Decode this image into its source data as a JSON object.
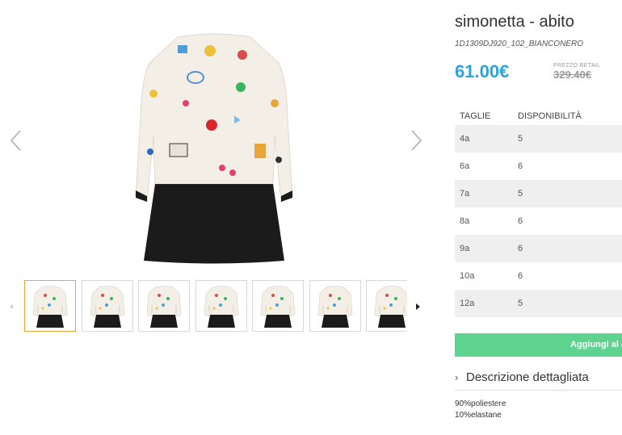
{
  "product": {
    "title": "simonetta - abito",
    "sku": "1D1309DJ920_102_BIANCONERO",
    "price": "61.00€",
    "retail_label": "PREZZO RETAIL",
    "retail_price": "329.40€"
  },
  "sizes_table": {
    "headers": [
      "TAGLIE",
      "DISPONIBILITÀ"
    ],
    "rows": [
      {
        "size": "4a",
        "qty": "5"
      },
      {
        "size": "6a",
        "qty": "6"
      },
      {
        "size": "7a",
        "qty": "5"
      },
      {
        "size": "8a",
        "qty": "6"
      },
      {
        "size": "9a",
        "qty": "6"
      },
      {
        "size": "10a",
        "qty": "6"
      },
      {
        "size": "12a",
        "qty": "5"
      }
    ]
  },
  "cart": {
    "label": "Aggiungi al carrello"
  },
  "description": {
    "toggle_label": "Descrizione dettagliata",
    "lines": [
      "90%poliestere",
      "10%elastane"
    ]
  },
  "gallery": {
    "thumbnail_count": 7,
    "active_thumbnail": 0,
    "icons": [
      "chevron-left-icon",
      "chevron-right-icon",
      "caret-left-icon",
      "caret-right-icon"
    ]
  },
  "colors": {
    "price": "#29a4e0",
    "cart_button": "#5ed28f",
    "active_thumb_border": "#f0a23a",
    "row_stripe": "#efefef",
    "dress_body": "#f3efe6",
    "dress_hem": "#1b1b1b"
  }
}
